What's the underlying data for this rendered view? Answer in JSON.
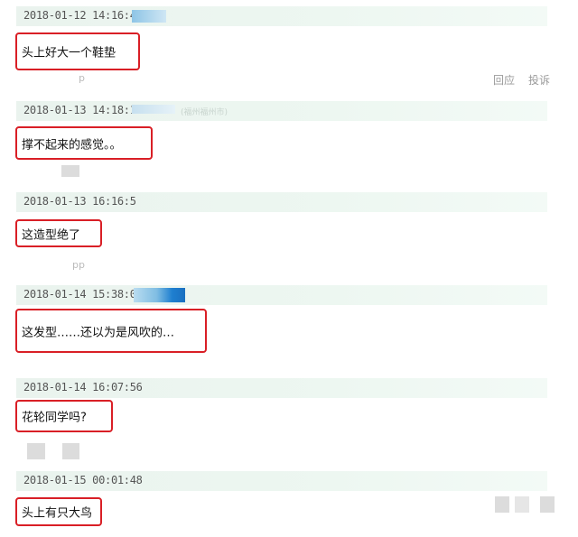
{
  "comments": [
    {
      "timestamp": "2018-01-12 14:16:4",
      "text": "头上好大一个鞋垫",
      "footer": "p"
    },
    {
      "timestamp": "2018-01-13 14:18:1",
      "text": "撑不起来的感觉。。",
      "faint": "(福州福州市)"
    },
    {
      "timestamp": "2018-01-13 16:16:5",
      "text": "这造型绝了",
      "footer": "pp"
    },
    {
      "timestamp": "2018-01-14 15:38:05",
      "text": "这发型……还以为是风吹的…"
    },
    {
      "timestamp": "2018-01-14 16:07:56",
      "text": "花轮同学吗?"
    },
    {
      "timestamp": "2018-01-15 00:01:48",
      "text": "头上有只大鸟"
    }
  ],
  "actions": {
    "reply": "回应",
    "report": "投诉"
  },
  "colors": {
    "highlight": "#d91f26",
    "header_bg": "#edf7f1",
    "blur_blue": "#4a9fd8"
  }
}
